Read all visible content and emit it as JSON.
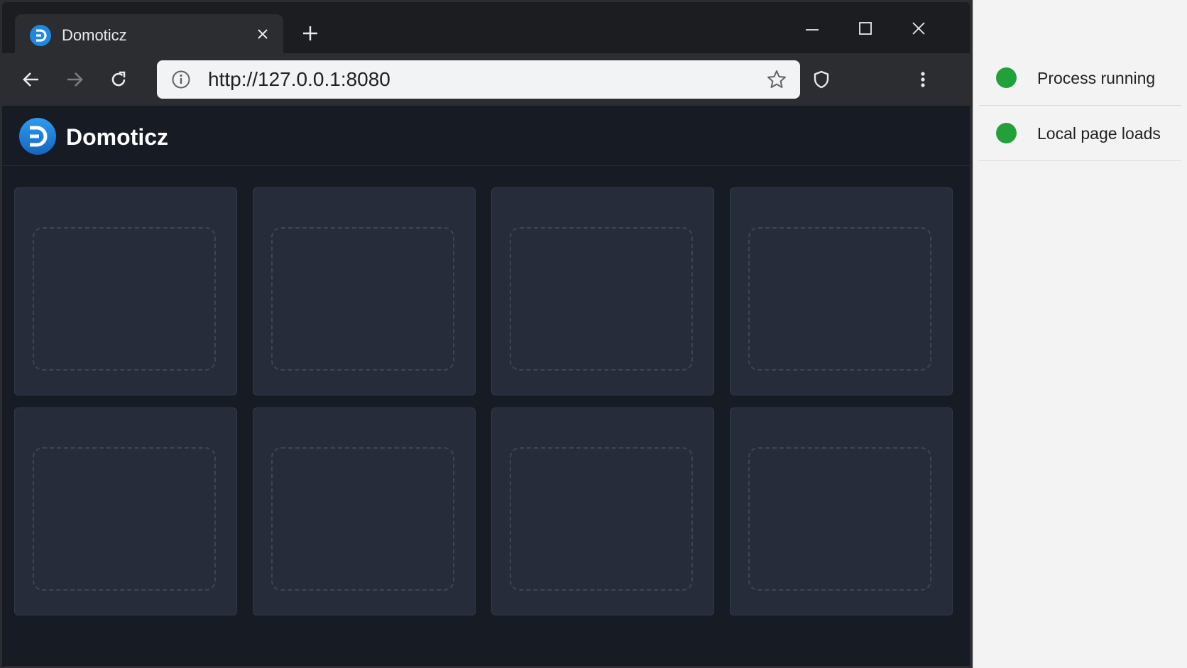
{
  "browser": {
    "tab": {
      "title": "Domoticz"
    },
    "address_bar": {
      "url": "http://127.0.0.1:8080"
    }
  },
  "app": {
    "title": "Domoticz",
    "cards": [
      {},
      {},
      {},
      {},
      {},
      {},
      {},
      {}
    ]
  },
  "status_panel": {
    "items": [
      {
        "label": "Process running",
        "status_color": "#22a03a"
      },
      {
        "label": "Local page loads",
        "status_color": "#22a03a"
      }
    ]
  },
  "colors": {
    "brand": "#1e88e5",
    "status_ok": "#22a03a"
  }
}
